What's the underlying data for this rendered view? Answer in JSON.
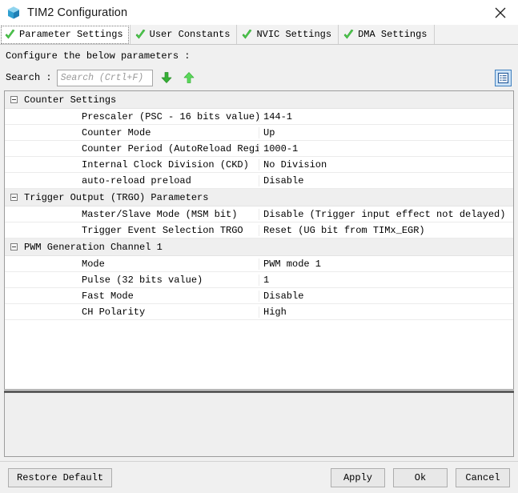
{
  "window": {
    "title": "TIM2 Configuration",
    "icon": "cube-icon",
    "close_label": "×"
  },
  "tabs": [
    {
      "label": "Parameter Settings",
      "icon": "green-check-icon",
      "active": true
    },
    {
      "label": "User Constants",
      "icon": "green-check-icon",
      "active": false
    },
    {
      "label": "NVIC Settings",
      "icon": "green-check-icon",
      "active": false
    },
    {
      "label": "DMA Settings",
      "icon": "green-check-icon",
      "active": false
    }
  ],
  "instruction": "Configure the below parameters :",
  "search": {
    "label": "Search :",
    "value": "",
    "placeholder": "Search (Crtl+F)",
    "find_next_icon": "arrow-down-icon",
    "find_prev_icon": "arrow-up-icon"
  },
  "toolbar": {
    "listview_icon": "list-view-icon"
  },
  "tree": {
    "groups": [
      {
        "label": "Counter Settings",
        "expanded": true,
        "rows": [
          {
            "name": "Prescaler (PSC - 16 bits value)",
            "value": "144-1"
          },
          {
            "name": "Counter Mode",
            "value": "Up"
          },
          {
            "name": "Counter Period (AutoReload Registe...",
            "value": "1000-1"
          },
          {
            "name": "Internal Clock Division (CKD)",
            "value": "No Division"
          },
          {
            "name": "auto-reload preload",
            "value": "Disable"
          }
        ]
      },
      {
        "label": "Trigger Output (TRGO) Parameters",
        "expanded": true,
        "rows": [
          {
            "name": "Master/Slave Mode (MSM bit)",
            "value": "Disable (Trigger input effect not delayed)"
          },
          {
            "name": "Trigger Event Selection TRGO",
            "value": "Reset (UG bit from TIMx_EGR)"
          }
        ]
      },
      {
        "label": "PWM Generation Channel 1",
        "expanded": true,
        "rows": [
          {
            "name": "Mode",
            "value": "PWM mode 1"
          },
          {
            "name": "Pulse (32 bits value)",
            "value": "1"
          },
          {
            "name": "Fast Mode",
            "value": "Disable"
          },
          {
            "name": "CH Polarity",
            "value": "High"
          }
        ]
      }
    ]
  },
  "description_panel": {
    "text": ""
  },
  "buttons": {
    "restore_default": "Restore Default",
    "apply": "Apply",
    "ok": "Ok",
    "cancel": "Cancel"
  },
  "colors": {
    "accent_blue": "#3f7fbf",
    "check_green": "#3fbf3f",
    "window_bg": "#f0f0f0",
    "tree_bg": "#ffffff",
    "group_row_bg": "#efefef"
  }
}
